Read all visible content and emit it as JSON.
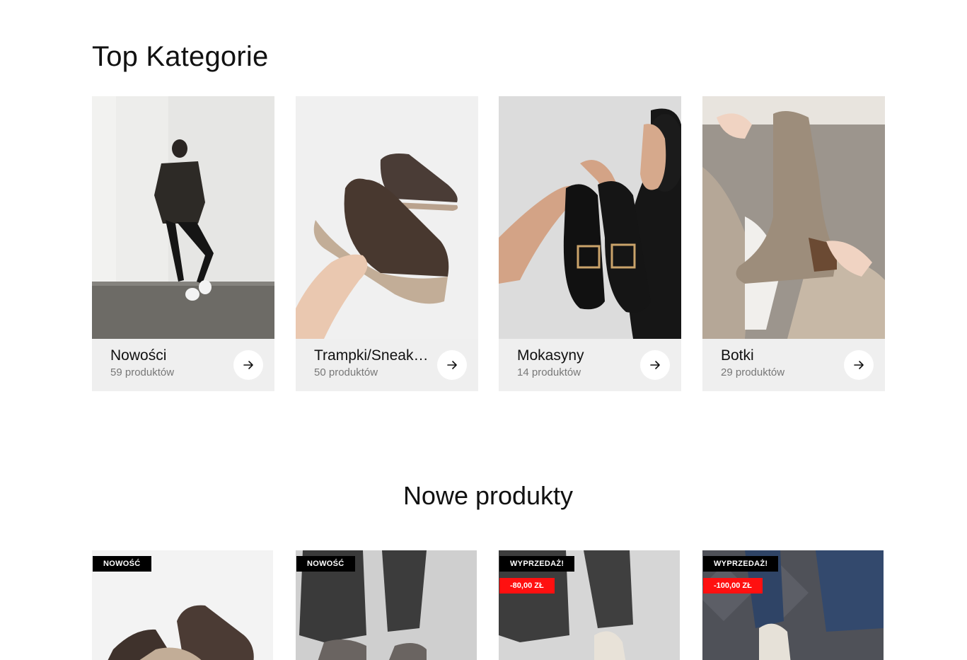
{
  "top_categories": {
    "title": "Top Kategorie",
    "items": [
      {
        "name": "Nowości",
        "count": "59 produktów"
      },
      {
        "name": "Trampki/Sneakersy",
        "count": "50 produktów"
      },
      {
        "name": "Mokasyny",
        "count": "14 produktów"
      },
      {
        "name": "Botki",
        "count": "29 produktów"
      }
    ]
  },
  "new_products": {
    "title": "Nowe produkty",
    "items": [
      {
        "badge": "NOWOŚĆ",
        "discount": null
      },
      {
        "badge": "NOWOŚĆ",
        "discount": null
      },
      {
        "badge": "WYPRZEDAŻ!",
        "discount": "-80,00 ZŁ"
      },
      {
        "badge": "WYPRZEDAŻ!",
        "discount": "-100,00 ZŁ"
      }
    ]
  },
  "colors": {
    "card_footer": "#efefef",
    "badge_black": "#000000",
    "badge_red": "#ff1010"
  },
  "icons": {
    "category_link": "arrow-right-icon"
  }
}
